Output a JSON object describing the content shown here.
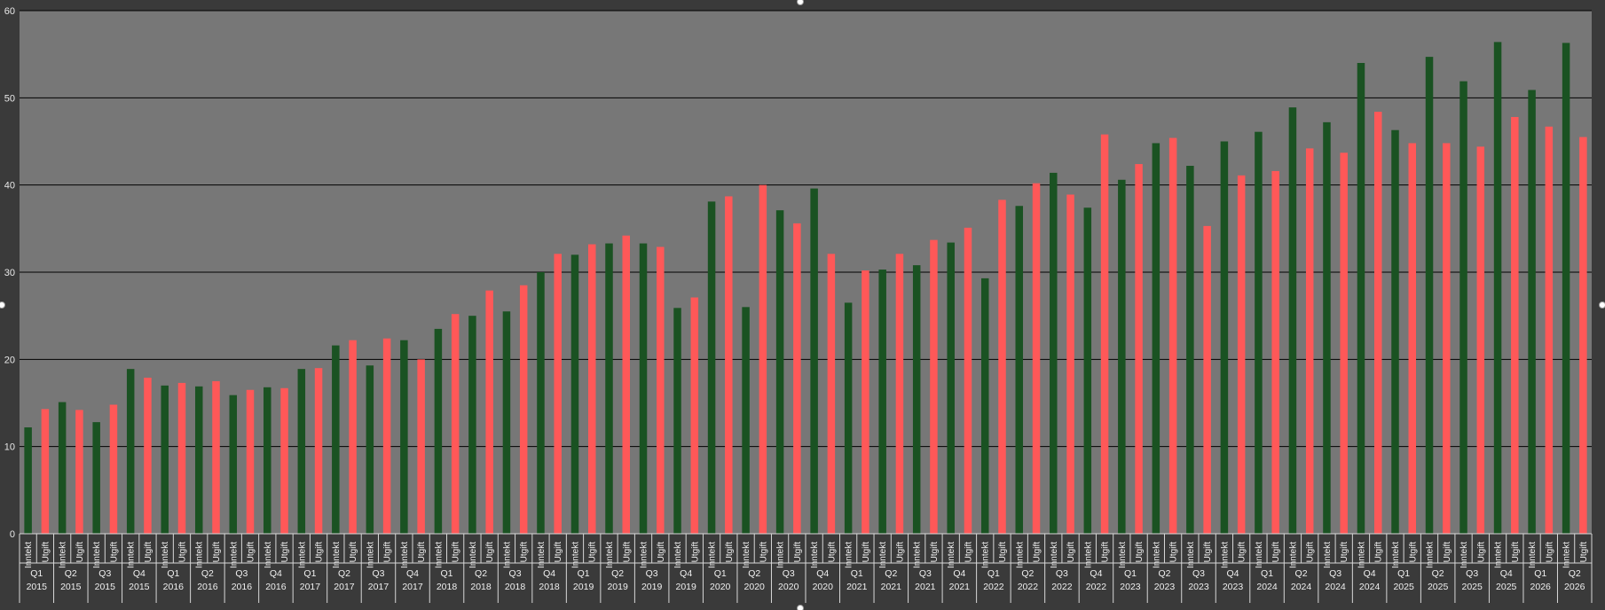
{
  "chart_data": {
    "type": "bar",
    "title": "",
    "xlabel": "",
    "ylabel": "",
    "ylim": [
      0,
      60
    ],
    "yticks": [
      "0",
      "10",
      "20",
      "30",
      "40",
      "50",
      "60"
    ],
    "grid": true,
    "colors": {
      "Inntekt": "#1a5222",
      "Utgift": "#ff5858",
      "plot_bg": "#777777",
      "outer_bg": "#3a3a3a"
    },
    "categories": [
      "Q1 2015",
      "Q2 2015",
      "Q3 2015",
      "Q4 2015",
      "Q1 2016",
      "Q2 2016",
      "Q3 2016",
      "Q4 2016",
      "Q1 2017",
      "Q2 2017",
      "Q3 2017",
      "Q4 2017",
      "Q1 2018",
      "Q2 2018",
      "Q3 2018",
      "Q4 2018",
      "Q1 2019",
      "Q2 2019",
      "Q3 2019",
      "Q4 2019",
      "Q1 2020",
      "Q2 2020",
      "Q3 2020",
      "Q4 2020",
      "Q1 2021",
      "Q2 2021",
      "Q3 2021",
      "Q4 2021",
      "Q1 2022",
      "Q2 2022",
      "Q3 2022",
      "Q4 2022",
      "Q1 2023",
      "Q2 2023",
      "Q3 2023",
      "Q4 2023",
      "Q1 2024",
      "Q2 2024",
      "Q3 2024",
      "Q4 2024",
      "Q1 2025",
      "Q2 2025",
      "Q3 2025",
      "Q4 2025",
      "Q1 2026",
      "Q2 2026"
    ],
    "groups": [
      {
        "quarter": "Q1",
        "year": "2015"
      },
      {
        "quarter": "Q2",
        "year": "2015"
      },
      {
        "quarter": "Q3",
        "year": "2015"
      },
      {
        "quarter": "Q4",
        "year": "2015"
      },
      {
        "quarter": "Q1",
        "year": "2016"
      },
      {
        "quarter": "Q2",
        "year": "2016"
      },
      {
        "quarter": "Q3",
        "year": "2016"
      },
      {
        "quarter": "Q4",
        "year": "2016"
      },
      {
        "quarter": "Q1",
        "year": "2017"
      },
      {
        "quarter": "Q2",
        "year": "2017"
      },
      {
        "quarter": "Q3",
        "year": "2017"
      },
      {
        "quarter": "Q4",
        "year": "2017"
      },
      {
        "quarter": "Q1",
        "year": "2018"
      },
      {
        "quarter": "Q2",
        "year": "2018"
      },
      {
        "quarter": "Q3",
        "year": "2018"
      },
      {
        "quarter": "Q4",
        "year": "2018"
      },
      {
        "quarter": "Q1",
        "year": "2019"
      },
      {
        "quarter": "Q2",
        "year": "2019"
      },
      {
        "quarter": "Q3",
        "year": "2019"
      },
      {
        "quarter": "Q4",
        "year": "2019"
      },
      {
        "quarter": "Q1",
        "year": "2020"
      },
      {
        "quarter": "Q2",
        "year": "2020"
      },
      {
        "quarter": "Q3",
        "year": "2020"
      },
      {
        "quarter": "Q4",
        "year": "2020"
      },
      {
        "quarter": "Q1",
        "year": "2021"
      },
      {
        "quarter": "Q2",
        "year": "2021"
      },
      {
        "quarter": "Q3",
        "year": "2021"
      },
      {
        "quarter": "Q4",
        "year": "2021"
      },
      {
        "quarter": "Q1",
        "year": "2022"
      },
      {
        "quarter": "Q2",
        "year": "2022"
      },
      {
        "quarter": "Q3",
        "year": "2022"
      },
      {
        "quarter": "Q4",
        "year": "2022"
      },
      {
        "quarter": "Q1",
        "year": "2023"
      },
      {
        "quarter": "Q2",
        "year": "2023"
      },
      {
        "quarter": "Q3",
        "year": "2023"
      },
      {
        "quarter": "Q4",
        "year": "2023"
      },
      {
        "quarter": "Q1",
        "year": "2024"
      },
      {
        "quarter": "Q2",
        "year": "2024"
      },
      {
        "quarter": "Q3",
        "year": "2024"
      },
      {
        "quarter": "Q4",
        "year": "2024"
      },
      {
        "quarter": "Q1",
        "year": "2025"
      },
      {
        "quarter": "Q2",
        "year": "2025"
      },
      {
        "quarter": "Q3",
        "year": "2025"
      },
      {
        "quarter": "Q4",
        "year": "2025"
      },
      {
        "quarter": "Q1",
        "year": "2026"
      },
      {
        "quarter": "Q2",
        "year": "2026"
      }
    ],
    "sub_categories": [
      "Inntekt",
      "Utgift"
    ],
    "series": [
      {
        "name": "Inntekt",
        "values": [
          12.2,
          15.1,
          12.8,
          18.9,
          17.0,
          16.9,
          15.9,
          16.8,
          18.9,
          21.6,
          19.3,
          22.2,
          23.5,
          25.0,
          25.5,
          30.0,
          32.0,
          33.3,
          33.3,
          25.9,
          38.1,
          26.0,
          37.1,
          39.6,
          26.5,
          30.3,
          30.8,
          33.4,
          29.3,
          37.6,
          41.4,
          37.4,
          40.6,
          44.8,
          42.2,
          45.0,
          46.1,
          48.9,
          47.2,
          54.0,
          46.3,
          54.7,
          51.9,
          56.4,
          50.9,
          56.3
        ]
      },
      {
        "name": "Utgift",
        "values": [
          14.3,
          14.2,
          14.8,
          17.9,
          17.3,
          17.5,
          16.5,
          16.7,
          19.0,
          22.2,
          22.4,
          20.0,
          25.2,
          27.9,
          28.5,
          32.1,
          33.2,
          34.2,
          32.9,
          27.1,
          38.7,
          40.0,
          35.6,
          32.1,
          30.2,
          32.1,
          33.7,
          35.1,
          38.3,
          40.2,
          38.9,
          45.8,
          42.4,
          45.4,
          35.3,
          41.1,
          41.6,
          44.2,
          43.7,
          48.4,
          44.8,
          44.8,
          44.4,
          47.8,
          46.7,
          45.5
        ]
      }
    ]
  }
}
